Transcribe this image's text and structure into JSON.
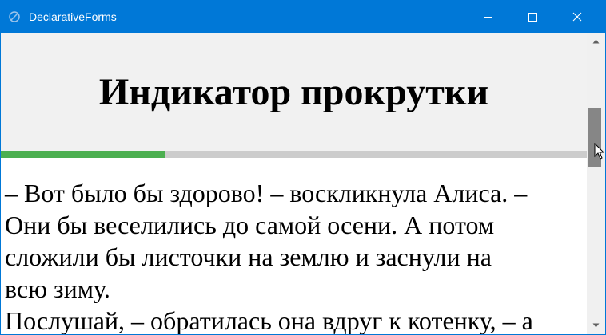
{
  "window": {
    "title": "DeclarativeForms",
    "accent_color": "#0078d7",
    "icons": {
      "app": "app-icon",
      "minimize": "minimize-icon",
      "maximize": "maximize-icon",
      "close": "close-icon"
    }
  },
  "page": {
    "title": "Индикатор прокрутки",
    "scroll_progress": 0.28,
    "progress_color": "#4caf50",
    "paragraphs": [
      "– Вот было бы здорово! – воскликнула Алиса. –",
      "Они бы веселились до самой осени. А потом",
      "сложили бы листочки на землю и заснули на",
      "всю зиму.",
      "Послушай, – обратилась она вдруг к котенку, – а"
    ]
  },
  "scrollbar": {
    "up_icon": "arrow-up-icon",
    "down_icon": "arrow-down-icon"
  }
}
